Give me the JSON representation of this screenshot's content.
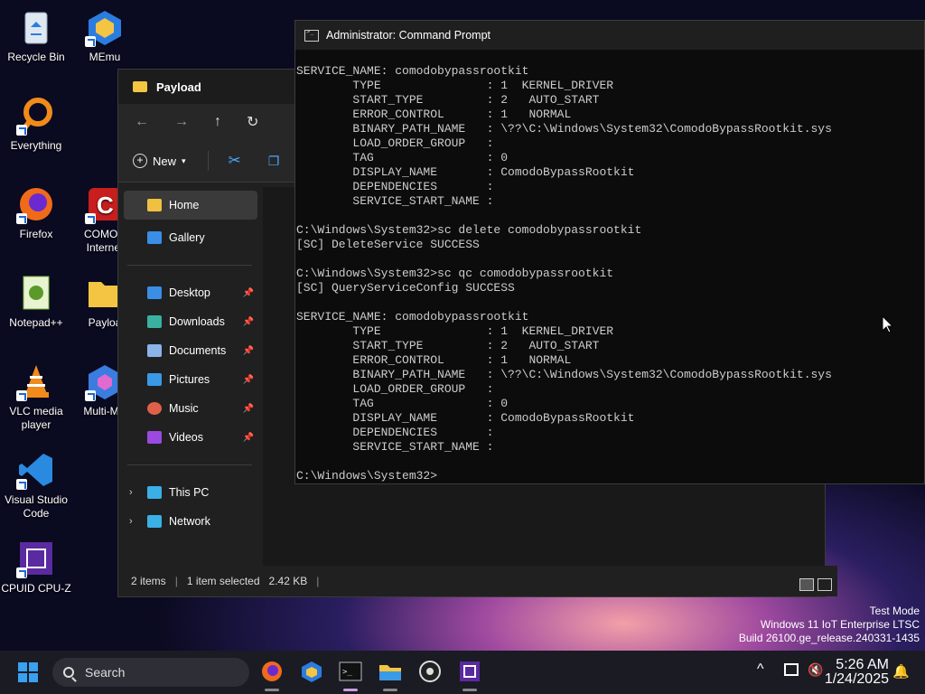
{
  "desktop": {
    "icons": [
      {
        "label": "Recycle Bin"
      },
      {
        "label": "MEmu"
      },
      {
        "label": "Everything"
      },
      {
        "label": "Firefox"
      },
      {
        "label": "COMOD Internet"
      },
      {
        "label": "Notepad++"
      },
      {
        "label": "Payloa"
      },
      {
        "label": "VLC media player"
      },
      {
        "label": "Multi-ME"
      },
      {
        "label": "Visual Studio Code"
      },
      {
        "label": "CPUID CPU-Z"
      }
    ]
  },
  "explorer": {
    "title": "Payload",
    "new_label": "New",
    "sidebar": [
      {
        "label": "Home",
        "icon": "home-icon",
        "color": "#f0c040"
      },
      {
        "label": "Gallery",
        "icon": "gallery-icon",
        "color": "#3a8ee6"
      },
      {
        "label": "Desktop",
        "icon": "desktop-icon",
        "color": "#3a8ee6",
        "pinned": true
      },
      {
        "label": "Downloads",
        "icon": "download-icon",
        "color": "#3ab0a0",
        "pinned": true
      },
      {
        "label": "Documents",
        "icon": "documents-icon",
        "color": "#8ab4e8",
        "pinned": true
      },
      {
        "label": "Pictures",
        "icon": "pictures-icon",
        "color": "#3a9ae6",
        "pinned": true
      },
      {
        "label": "Music",
        "icon": "music-icon",
        "color": "#e0604a",
        "pinned": true
      },
      {
        "label": "Videos",
        "icon": "videos-icon",
        "color": "#9a4ae0",
        "pinned": true
      },
      {
        "label": "This PC",
        "icon": "pc-icon",
        "color": "#3ab0e6"
      },
      {
        "label": "Network",
        "icon": "network-icon",
        "color": "#3ab0e6"
      }
    ],
    "status": {
      "items": "2 items",
      "selected": "1 item selected",
      "size": "2.42 KB"
    }
  },
  "terminal": {
    "title": "Administrator: Command Prompt",
    "output": "SERVICE_NAME: comodobypassrootkit\n        TYPE               : 1  KERNEL_DRIVER\n        START_TYPE         : 2   AUTO_START\n        ERROR_CONTROL      : 1   NORMAL\n        BINARY_PATH_NAME   : \\??\\C:\\Windows\\System32\\ComodoBypassRootkit.sys\n        LOAD_ORDER_GROUP   :\n        TAG                : 0\n        DISPLAY_NAME       : ComodoBypassRootkit\n        DEPENDENCIES       :\n        SERVICE_START_NAME :\n\nC:\\Windows\\System32>sc delete comodobypassrootkit\n[SC] DeleteService SUCCESS\n\nC:\\Windows\\System32>sc qc comodobypassrootkit\n[SC] QueryServiceConfig SUCCESS\n\nSERVICE_NAME: comodobypassrootkit\n        TYPE               : 1  KERNEL_DRIVER\n        START_TYPE         : 2   AUTO_START\n        ERROR_CONTROL      : 1   NORMAL\n        BINARY_PATH_NAME   : \\??\\C:\\Windows\\System32\\ComodoBypassRootkit.sys\n        LOAD_ORDER_GROUP   :\n        TAG                : 0\n        DISPLAY_NAME       : ComodoBypassRootkit\n        DEPENDENCIES       :\n        SERVICE_START_NAME :\n\nC:\\Windows\\System32>"
  },
  "watermark": {
    "line1": "Test Mode",
    "line2": "Windows 11 IoT Enterprise LTSC",
    "line3": "Build 26100.ge_release.240331-1435"
  },
  "taskbar": {
    "search_label": "Search",
    "time": "5:26 AM",
    "date": "1/24/2025"
  }
}
